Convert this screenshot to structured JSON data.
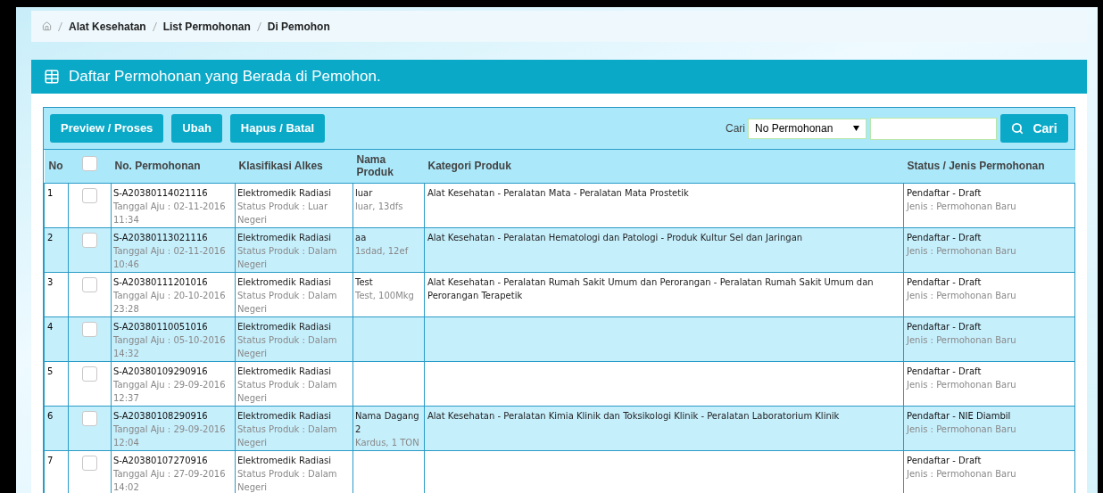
{
  "breadcrumb": [
    "Alat Kesehatan",
    "List Permohonan",
    "Di Pemohon"
  ],
  "panel": {
    "title": "Daftar Permohonan yang Berada di Pemohon."
  },
  "toolbar": {
    "buttons": [
      "Preview / Proses",
      "Ubah",
      "Hapus / Batal"
    ],
    "search_label": "Cari",
    "search_by": "No Permohonan",
    "search_button": "Cari"
  },
  "table": {
    "columns": [
      "No",
      "No. Permohonan",
      "Klasifikasi Alkes",
      "Nama Produk",
      "Kategori Produk",
      "Status / Jenis Permohonan"
    ],
    "select_all_checked": false,
    "rows": [
      {
        "no": "1",
        "checked": false,
        "no_permohonan": "S-A20380114021116",
        "tanggal": "Tanggal Aju : 02-11-2016 11:34",
        "klasifikasi": "Elektromedik Radiasi",
        "status_produk": "Status Produk : Luar Negeri",
        "nama_produk": "luar",
        "nama_produk_detail": "luar, 13dfs",
        "kategori": "Alat Kesehatan - Peralatan Mata - Peralatan Mata Prostetik",
        "status": "Pendaftar - Draft",
        "jenis": "Jenis : Permohonan Baru"
      },
      {
        "no": "2",
        "checked": false,
        "no_permohonan": "S-A20380113021116",
        "tanggal": "Tanggal Aju : 02-11-2016 10:46",
        "klasifikasi": "Elektromedik Radiasi",
        "status_produk": "Status Produk : Dalam Negeri",
        "nama_produk": "aa",
        "nama_produk_detail": "1sdad, 12ef",
        "kategori": "Alat Kesehatan - Peralatan Hematologi dan Patologi - Produk Kultur Sel dan Jaringan",
        "status": "Pendaftar - Draft",
        "jenis": "Jenis : Permohonan Baru"
      },
      {
        "no": "3",
        "checked": false,
        "no_permohonan": "S-A20380111201016",
        "tanggal": "Tanggal Aju : 20-10-2016 23:28",
        "klasifikasi": "Elektromedik Radiasi",
        "status_produk": "Status Produk : Dalam Negeri",
        "nama_produk": "Test",
        "nama_produk_detail": "Test, 100Mkg",
        "kategori": "Alat Kesehatan - Peralatan Rumah Sakit Umum dan Perorangan - Peralatan Rumah Sakit Umum dan Perorangan Terapetik",
        "status": "Pendaftar - Draft",
        "jenis": "Jenis : Permohonan Baru"
      },
      {
        "no": "4",
        "checked": false,
        "no_permohonan": "S-A20380110051016",
        "tanggal": "Tanggal Aju : 05-10-2016 14:32",
        "klasifikasi": "Elektromedik Radiasi",
        "status_produk": "Status Produk : Dalam Negeri",
        "status": "Pendaftar - Draft",
        "jenis": "Jenis : Permohonan Baru"
      },
      {
        "no": "5",
        "checked": false,
        "no_permohonan": "S-A20380109290916",
        "tanggal": "Tanggal Aju : 29-09-2016 12:37",
        "klasifikasi": "Elektromedik Radiasi",
        "status_produk": "Status Produk : Dalam Negeri",
        "status": "Pendaftar - Draft",
        "jenis": "Jenis : Permohonan Baru"
      },
      {
        "no": "6",
        "checked": false,
        "no_permohonan": "S-A20380108290916",
        "tanggal": "Tanggal Aju : 29-09-2016 12:04",
        "klasifikasi": "Elektromedik Radiasi",
        "status_produk": "Status Produk : Dalam Negeri",
        "nama_produk": "Nama Dagang 2",
        "nama_produk_detail": "Kardus, 1 TON",
        "kategori": "Alat Kesehatan - Peralatan Kimia Klinik dan Toksikologi Klinik - Peralatan Laboratorium Klinik",
        "status": "Pendaftar - NIE Diambil",
        "jenis": "Jenis : Permohonan Baru"
      },
      {
        "no": "7",
        "checked": false,
        "no_permohonan": "S-A20380107270916",
        "tanggal": "Tanggal Aju : 27-09-2016 14:02",
        "klasifikasi": "Elektromedik Radiasi",
        "status_produk": "Status Produk : Dalam Negeri",
        "status": "Pendaftar - Draft",
        "jenis": "Jenis : Permohonan Baru"
      }
    ]
  }
}
